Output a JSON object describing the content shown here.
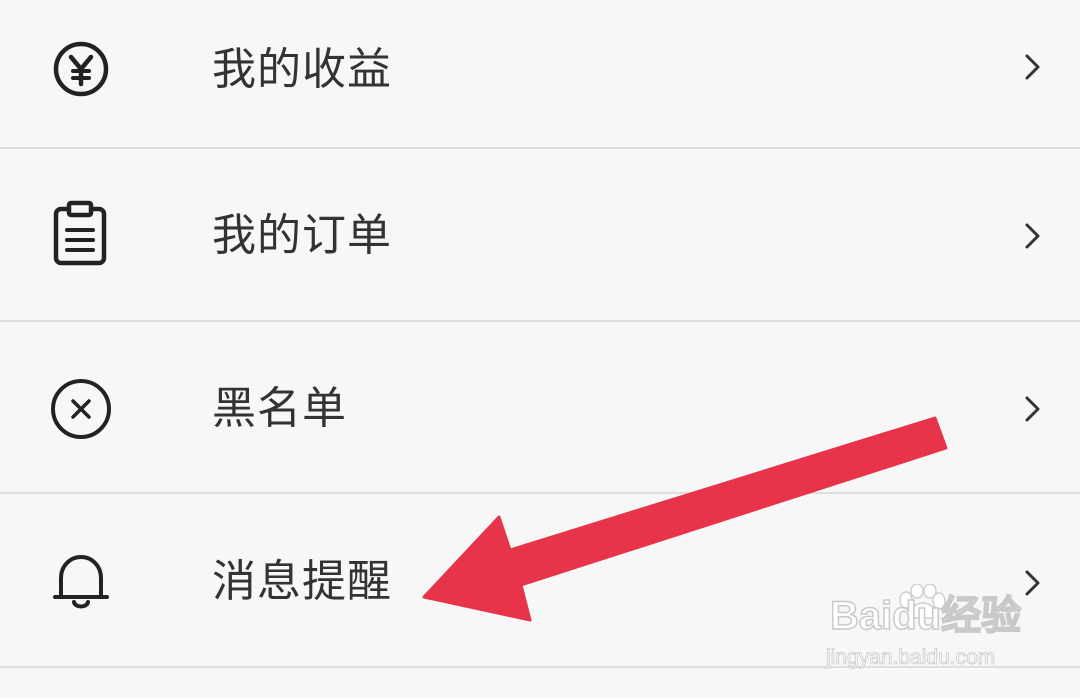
{
  "menu": {
    "items": [
      {
        "label": "我的收益",
        "icon": "yuan-circle-icon"
      },
      {
        "label": "我的订单",
        "icon": "clipboard-icon"
      },
      {
        "label": "黑名单",
        "icon": "x-circle-icon"
      },
      {
        "label": "消息提醒",
        "icon": "bell-icon"
      }
    ],
    "chevron_icon": "chevron-right-icon"
  },
  "annotation": {
    "arrow_icon": "red-arrow-pointer",
    "arrow_color": "#e8344a",
    "points_to": "消息提醒"
  },
  "watermark": {
    "logo_text": "Baidu经验",
    "url_text": "jingyan.baidu.com"
  },
  "colors": {
    "background": "#f7f7f7",
    "text": "#333333",
    "divider": "#dedede",
    "icon": "#222222"
  }
}
